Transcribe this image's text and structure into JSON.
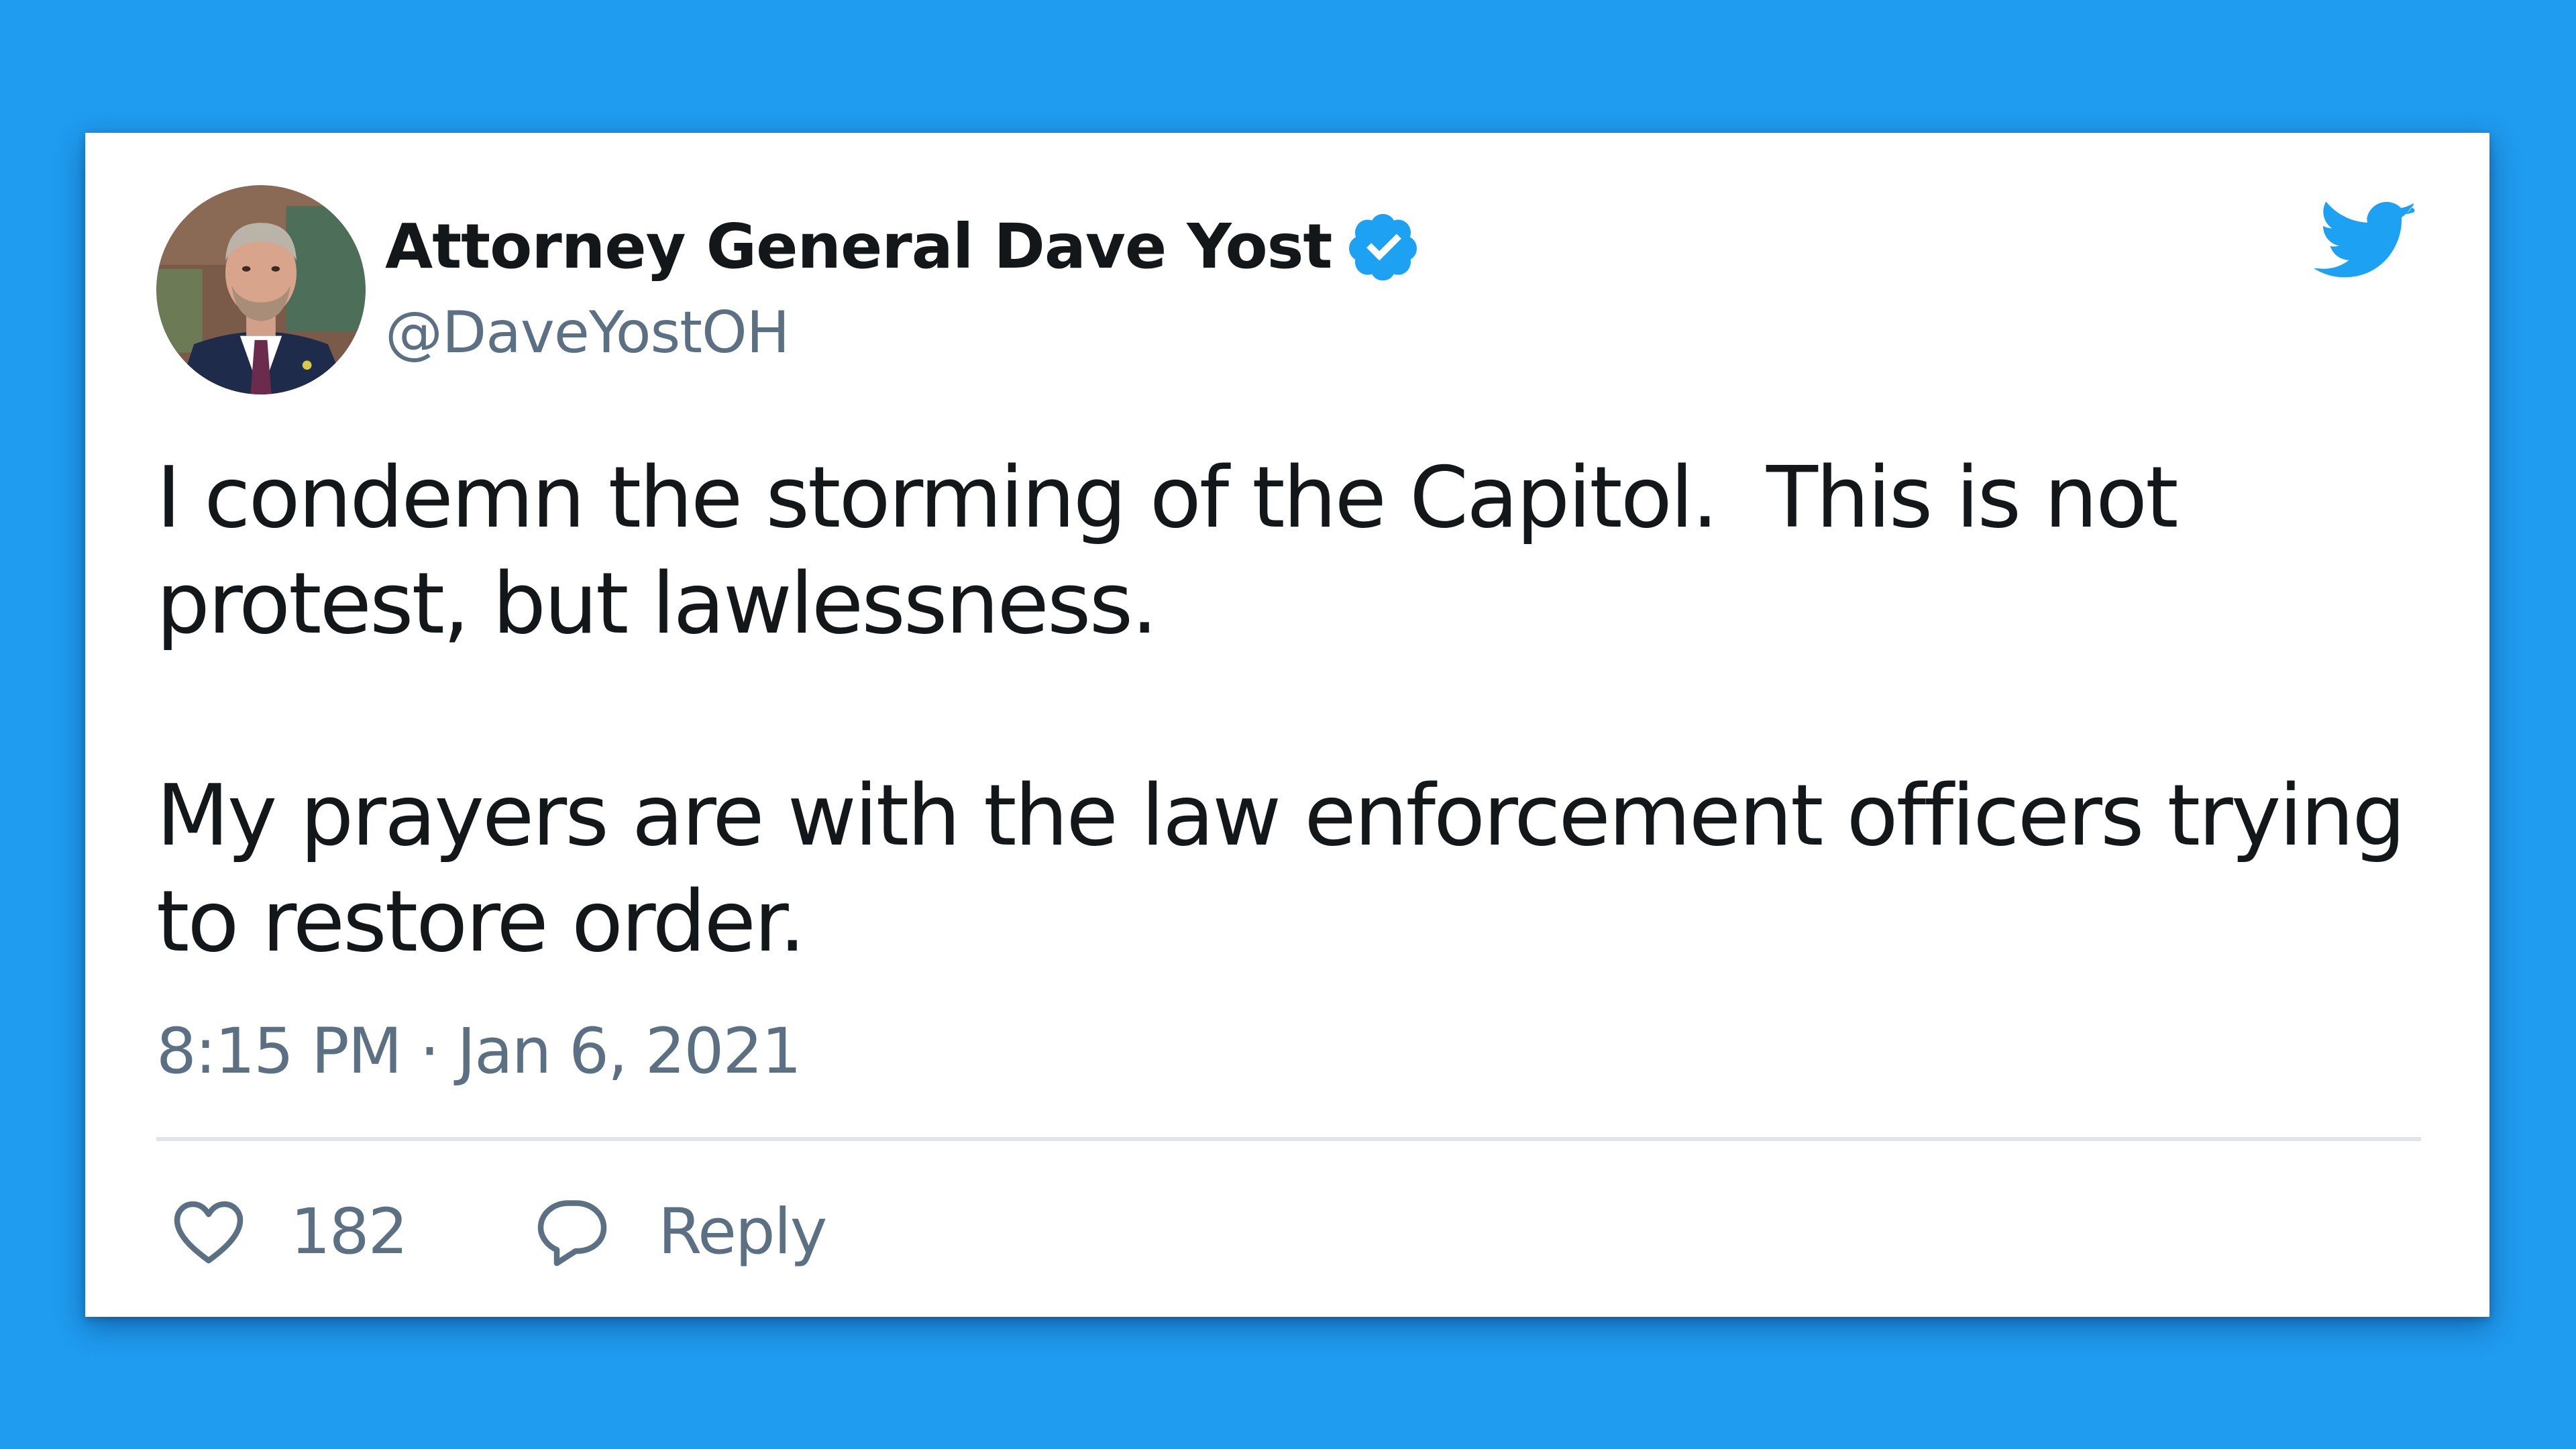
{
  "colors": {
    "background": "#1f9bef",
    "card": "#ffffff",
    "text_primary": "#14171a",
    "text_secondary": "#5b7083",
    "twitter_blue": "#1da1f2",
    "divider": "#e1e5e8"
  },
  "author": {
    "display_name": "Attorney General Dave Yost",
    "handle": "@DaveYostOH",
    "verified_icon": "verified-badge-icon",
    "avatar": "profile-photo"
  },
  "brand_icon": "twitter-bird-icon",
  "tweet": {
    "paragraphs": [
      "I condemn the storming of the Capitol.  This is not\nprotest, but lawlessness.",
      "My prayers are with the law enforcement officers trying\nto restore order."
    ],
    "timestamp": "8:15 PM · Jan 6, 2021"
  },
  "actions": {
    "like_icon": "heart-icon",
    "like_count": "182",
    "reply_icon": "speech-bubble-icon",
    "reply_label": "Reply"
  }
}
